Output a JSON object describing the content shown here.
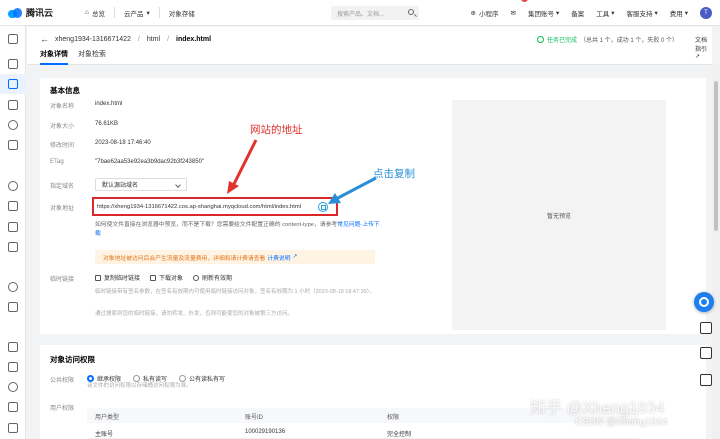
{
  "topbar": {
    "brand": "腾讯云",
    "nav": [
      "总览",
      "云产品",
      "对象存储"
    ],
    "search_placeholder": "搜索产品、文档...",
    "right": [
      "小程序",
      "集团账号",
      "备案",
      "工具",
      "客服支持",
      "费用"
    ],
    "mail_badge": "3",
    "avatar_letter": "T"
  },
  "header": {
    "back": "←",
    "crumbs": [
      "xheng1934-1316671422",
      "html",
      "index.html"
    ],
    "tabs": [
      "对象详情",
      "对象检索"
    ],
    "task_status": "任务已完成",
    "task_detail": "（总共 1 个，成功 1 个，失败 0 个）",
    "doc_link": "文档指引"
  },
  "basic": {
    "title": "基本信息",
    "fields": [
      {
        "label": "对象名称",
        "value": "index.html"
      },
      {
        "label": "对象大小",
        "value": "76.61KB"
      },
      {
        "label": "修改时间",
        "value": "2023-08-18 17:46:40"
      },
      {
        "label": "ETag",
        "value": "\"7bae62aa53e92ea3b9dac92b3f243850\""
      }
    ],
    "domain_label": "指定域名",
    "domain_value": "默认源站域名",
    "url_label": "对象地址",
    "url_value": "https://xheng1934-1316671422.cos.ap-shanghai.myqcloud.com/html/index.html",
    "hint": "如何使文件直接在浏览器中预览，而不是下载？您需要给文件配置正确的 content-type，请参考",
    "hint_link": "常见问题-上传下载",
    "warn": "对象地址被访问后会产生流量及流量费用，详细和请计费请查看",
    "warn_link": "计费说明",
    "temp_label": "临时链接",
    "actions": [
      "复制临时链接",
      "下载对象",
      "刷新有效期"
    ],
    "note1": "临时链接带有签名参数，在签名有效期内可使用临时链接访问对象，签名有效期为 1 小时（2023-08-18 18:47:39）。",
    "note2": "通过搜索到您的临时链接，请勿转发、外发，否则可能使您的对象被第三方访问。",
    "preview": "暂无预览"
  },
  "annotations": {
    "site_address": "网站的地址",
    "click_copy": "点击复制"
  },
  "access": {
    "title": "对象访问权限",
    "public_label": "公共权限",
    "options": [
      "继承权限",
      "私有读写",
      "公有读私有写"
    ],
    "sub_note": "该文件的访问权限以存储桶访问权限为准。",
    "user_label": "用户权限",
    "columns": [
      "用户类型",
      "账号ID",
      "权限"
    ],
    "row": [
      "主账号",
      "100029190136",
      "完全控制"
    ]
  },
  "watermark": {
    "line1": "知乎 @Xheng1934",
    "line2": "CSDN @Xheng1934"
  }
}
